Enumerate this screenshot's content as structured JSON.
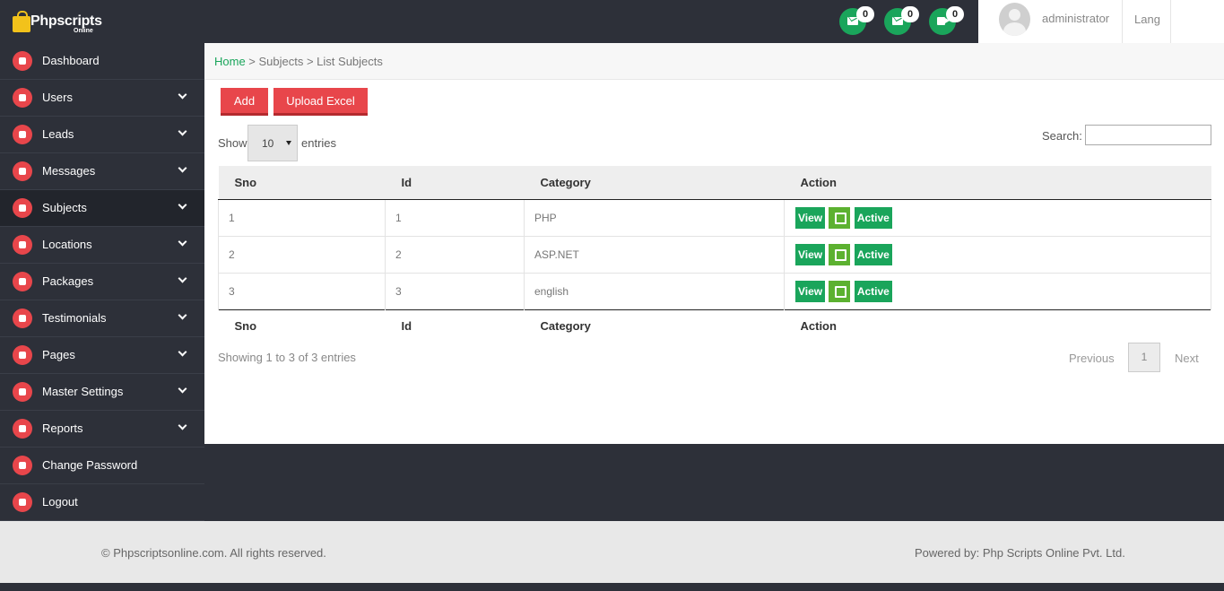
{
  "brand": {
    "name": "Phpscripts",
    "sub": "Online"
  },
  "notifications": [
    {
      "icon": "mail-icon",
      "count": "0"
    },
    {
      "icon": "mail-icon",
      "count": "0"
    },
    {
      "icon": "video-icon",
      "count": "0"
    }
  ],
  "user": {
    "name": "administrator",
    "lang": "Lang"
  },
  "sidebar": {
    "items": [
      {
        "label": "Dashboard",
        "icon": "dashboard-icon",
        "chevron": false
      },
      {
        "label": "Users",
        "icon": "users-icon",
        "chevron": true
      },
      {
        "label": "Leads",
        "icon": "leads-icon",
        "chevron": true
      },
      {
        "label": "Messages",
        "icon": "messages-icon",
        "chevron": true
      },
      {
        "label": "Subjects",
        "icon": "subjects-icon",
        "chevron": true,
        "active": true
      },
      {
        "label": "Locations",
        "icon": "locations-icon",
        "chevron": true
      },
      {
        "label": "Packages",
        "icon": "packages-icon",
        "chevron": true
      },
      {
        "label": "Testimonials",
        "icon": "testimonials-icon",
        "chevron": true
      },
      {
        "label": "Pages",
        "icon": "pages-icon",
        "chevron": true
      },
      {
        "label": "Master Settings",
        "icon": "settings-icon",
        "chevron": true
      },
      {
        "label": "Reports",
        "icon": "reports-icon",
        "chevron": true
      },
      {
        "label": "Change Password",
        "icon": "password-icon",
        "chevron": false
      },
      {
        "label": "Logout",
        "icon": "logout-icon",
        "chevron": false
      }
    ]
  },
  "breadcrumb": {
    "home": "Home",
    "rest": " > Subjects > List Subjects"
  },
  "toolbar": {
    "add_label": "Add",
    "upload_label": "Upload Excel"
  },
  "length": {
    "show": "Show",
    "value": "10",
    "entries": "entries"
  },
  "search": {
    "label": "Search:",
    "value": ""
  },
  "table": {
    "headers": [
      "Sno",
      "Id",
      "Category",
      "Action"
    ],
    "rows": [
      {
        "sno": "1",
        "id": "1",
        "category": "PHP"
      },
      {
        "sno": "2",
        "id": "2",
        "category": "ASP.NET"
      },
      {
        "sno": "3",
        "id": "3",
        "category": "english"
      }
    ],
    "actions": {
      "view": "View",
      "active": "Active"
    }
  },
  "pagination": {
    "info": "Showing 1 to 3 of 3 entries",
    "previous": "Previous",
    "page": "1",
    "next": "Next"
  },
  "footer": {
    "copyright": "© Phpscriptsonline.com. All rights reserved.",
    "powered": "Powered by: Php Scripts Online Pvt. Ltd."
  },
  "colors": {
    "accent_red": "#e8464b",
    "accent_green": "#1aa55b",
    "dark": "#2d3039"
  }
}
